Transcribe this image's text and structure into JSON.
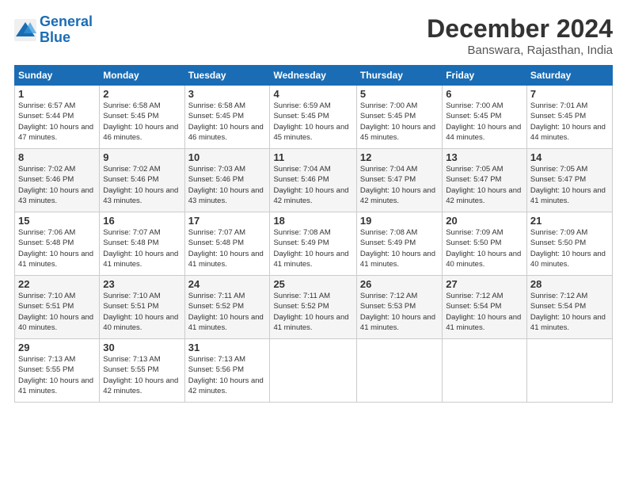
{
  "logo": {
    "line1": "General",
    "line2": "Blue"
  },
  "header": {
    "month": "December 2024",
    "location": "Banswara, Rajasthan, India"
  },
  "weekdays": [
    "Sunday",
    "Monday",
    "Tuesday",
    "Wednesday",
    "Thursday",
    "Friday",
    "Saturday"
  ],
  "weeks": [
    [
      {
        "day": "1",
        "sunrise": "6:57 AM",
        "sunset": "5:44 PM",
        "daylight": "10 hours and 47 minutes."
      },
      {
        "day": "2",
        "sunrise": "6:58 AM",
        "sunset": "5:45 PM",
        "daylight": "10 hours and 46 minutes."
      },
      {
        "day": "3",
        "sunrise": "6:58 AM",
        "sunset": "5:45 PM",
        "daylight": "10 hours and 46 minutes."
      },
      {
        "day": "4",
        "sunrise": "6:59 AM",
        "sunset": "5:45 PM",
        "daylight": "10 hours and 45 minutes."
      },
      {
        "day": "5",
        "sunrise": "7:00 AM",
        "sunset": "5:45 PM",
        "daylight": "10 hours and 45 minutes."
      },
      {
        "day": "6",
        "sunrise": "7:00 AM",
        "sunset": "5:45 PM",
        "daylight": "10 hours and 44 minutes."
      },
      {
        "day": "7",
        "sunrise": "7:01 AM",
        "sunset": "5:45 PM",
        "daylight": "10 hours and 44 minutes."
      }
    ],
    [
      {
        "day": "8",
        "sunrise": "7:02 AM",
        "sunset": "5:46 PM",
        "daylight": "10 hours and 43 minutes."
      },
      {
        "day": "9",
        "sunrise": "7:02 AM",
        "sunset": "5:46 PM",
        "daylight": "10 hours and 43 minutes."
      },
      {
        "day": "10",
        "sunrise": "7:03 AM",
        "sunset": "5:46 PM",
        "daylight": "10 hours and 43 minutes."
      },
      {
        "day": "11",
        "sunrise": "7:04 AM",
        "sunset": "5:46 PM",
        "daylight": "10 hours and 42 minutes."
      },
      {
        "day": "12",
        "sunrise": "7:04 AM",
        "sunset": "5:47 PM",
        "daylight": "10 hours and 42 minutes."
      },
      {
        "day": "13",
        "sunrise": "7:05 AM",
        "sunset": "5:47 PM",
        "daylight": "10 hours and 42 minutes."
      },
      {
        "day": "14",
        "sunrise": "7:05 AM",
        "sunset": "5:47 PM",
        "daylight": "10 hours and 41 minutes."
      }
    ],
    [
      {
        "day": "15",
        "sunrise": "7:06 AM",
        "sunset": "5:48 PM",
        "daylight": "10 hours and 41 minutes."
      },
      {
        "day": "16",
        "sunrise": "7:07 AM",
        "sunset": "5:48 PM",
        "daylight": "10 hours and 41 minutes."
      },
      {
        "day": "17",
        "sunrise": "7:07 AM",
        "sunset": "5:48 PM",
        "daylight": "10 hours and 41 minutes."
      },
      {
        "day": "18",
        "sunrise": "7:08 AM",
        "sunset": "5:49 PM",
        "daylight": "10 hours and 41 minutes."
      },
      {
        "day": "19",
        "sunrise": "7:08 AM",
        "sunset": "5:49 PM",
        "daylight": "10 hours and 41 minutes."
      },
      {
        "day": "20",
        "sunrise": "7:09 AM",
        "sunset": "5:50 PM",
        "daylight": "10 hours and 40 minutes."
      },
      {
        "day": "21",
        "sunrise": "7:09 AM",
        "sunset": "5:50 PM",
        "daylight": "10 hours and 40 minutes."
      }
    ],
    [
      {
        "day": "22",
        "sunrise": "7:10 AM",
        "sunset": "5:51 PM",
        "daylight": "10 hours and 40 minutes."
      },
      {
        "day": "23",
        "sunrise": "7:10 AM",
        "sunset": "5:51 PM",
        "daylight": "10 hours and 40 minutes."
      },
      {
        "day": "24",
        "sunrise": "7:11 AM",
        "sunset": "5:52 PM",
        "daylight": "10 hours and 41 minutes."
      },
      {
        "day": "25",
        "sunrise": "7:11 AM",
        "sunset": "5:52 PM",
        "daylight": "10 hours and 41 minutes."
      },
      {
        "day": "26",
        "sunrise": "7:12 AM",
        "sunset": "5:53 PM",
        "daylight": "10 hours and 41 minutes."
      },
      {
        "day": "27",
        "sunrise": "7:12 AM",
        "sunset": "5:54 PM",
        "daylight": "10 hours and 41 minutes."
      },
      {
        "day": "28",
        "sunrise": "7:12 AM",
        "sunset": "5:54 PM",
        "daylight": "10 hours and 41 minutes."
      }
    ],
    [
      {
        "day": "29",
        "sunrise": "7:13 AM",
        "sunset": "5:55 PM",
        "daylight": "10 hours and 41 minutes."
      },
      {
        "day": "30",
        "sunrise": "7:13 AM",
        "sunset": "5:55 PM",
        "daylight": "10 hours and 42 minutes."
      },
      {
        "day": "31",
        "sunrise": "7:13 AM",
        "sunset": "5:56 PM",
        "daylight": "10 hours and 42 minutes."
      },
      null,
      null,
      null,
      null
    ]
  ]
}
